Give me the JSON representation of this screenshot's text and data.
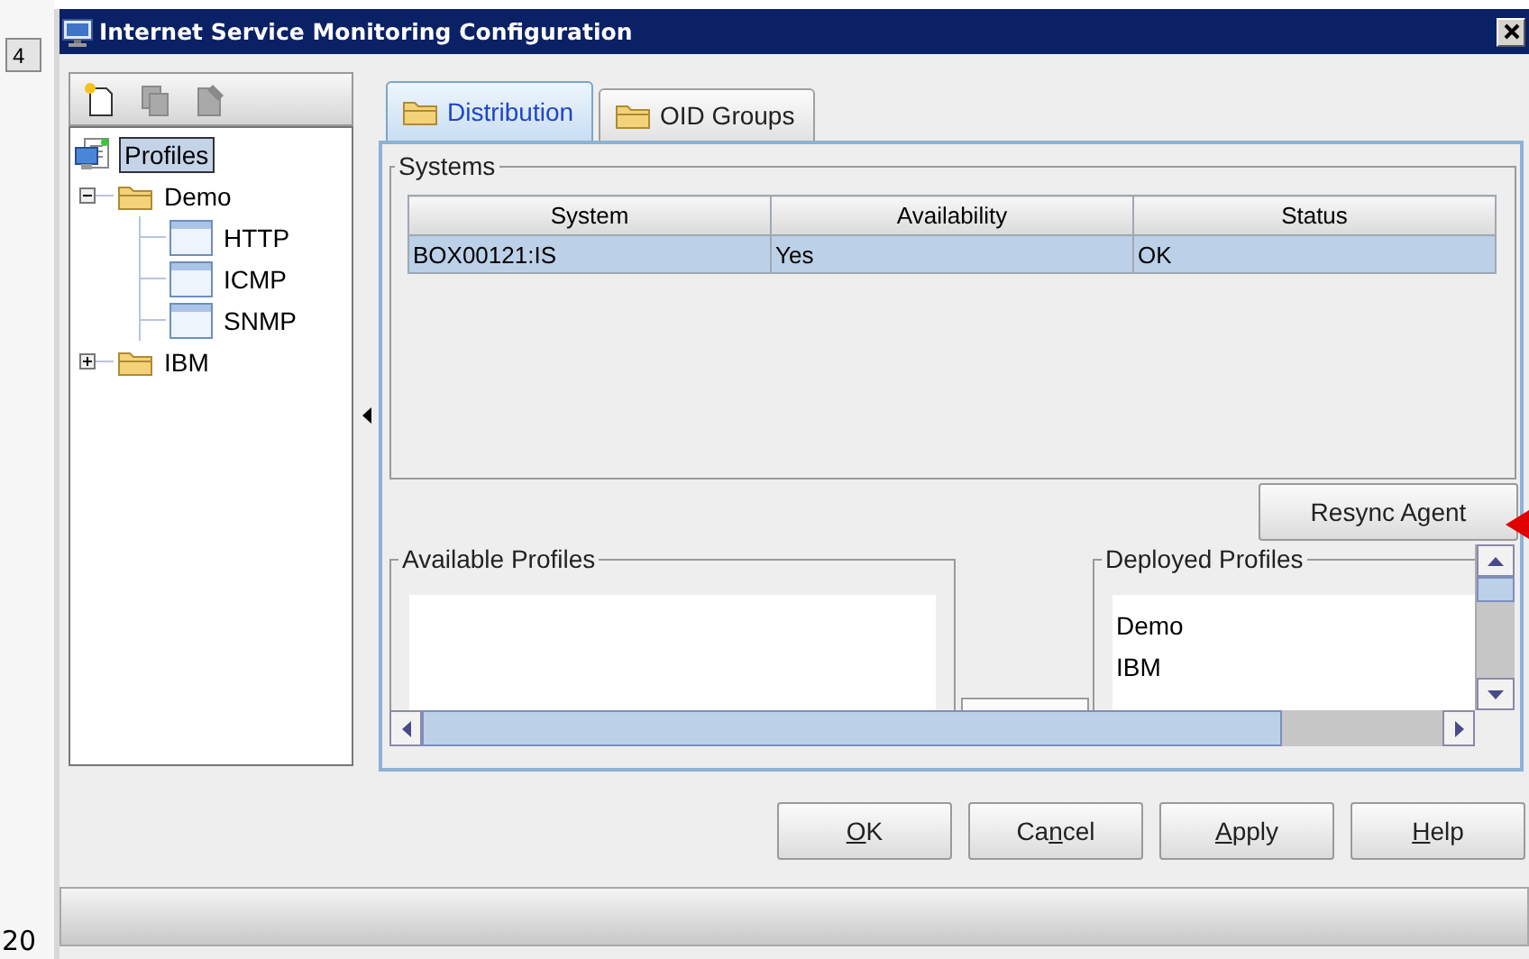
{
  "background_app": {
    "texts": [
      "4",
      "20"
    ]
  },
  "window": {
    "title": "Internet Service Monitoring Configuration"
  },
  "toolbar": [
    {
      "kind": "new",
      "disabled": false
    },
    {
      "kind": "copy",
      "disabled": true
    },
    {
      "kind": "edit",
      "disabled": true
    }
  ],
  "tree": {
    "label": "Profiles",
    "kind": "root",
    "selected": true,
    "children": [
      {
        "label": "Demo",
        "kind": "folder",
        "selected": false,
        "expanded": true,
        "children": [
          {
            "label": "HTTP",
            "kind": "profile",
            "selected": false
          },
          {
            "label": "ICMP",
            "kind": "profile",
            "selected": false
          },
          {
            "label": "SNMP",
            "kind": "profile",
            "selected": false
          }
        ]
      },
      {
        "label": "IBM",
        "kind": "folder",
        "selected": false,
        "expanded": false
      }
    ]
  },
  "tabs": [
    {
      "label": "Distribution",
      "selected": true
    },
    {
      "label": "OID Groups",
      "selected": false
    }
  ],
  "systems": {
    "title": "Systems",
    "columns": [
      "System",
      "Availability",
      "Status"
    ],
    "rows": [
      {
        "cells": [
          "BOX00121:IS",
          "Yes",
          "OK"
        ],
        "selected": true
      }
    ]
  },
  "resync_button": "Resync Agent",
  "available_profiles": {
    "title": "Available Profiles"
  },
  "deployed_profiles": {
    "title": "Deployed Profiles",
    "items": [
      "Demo",
      "IBM"
    ]
  },
  "buttons": [
    {
      "mnemonic": "O",
      "after": "K"
    },
    {
      "before": "Ca",
      "mnemonic": "n",
      "after": "cel"
    },
    {
      "mnemonic": "A",
      "after": "pply"
    },
    {
      "mnemonic": "H",
      "after": "elp"
    }
  ]
}
